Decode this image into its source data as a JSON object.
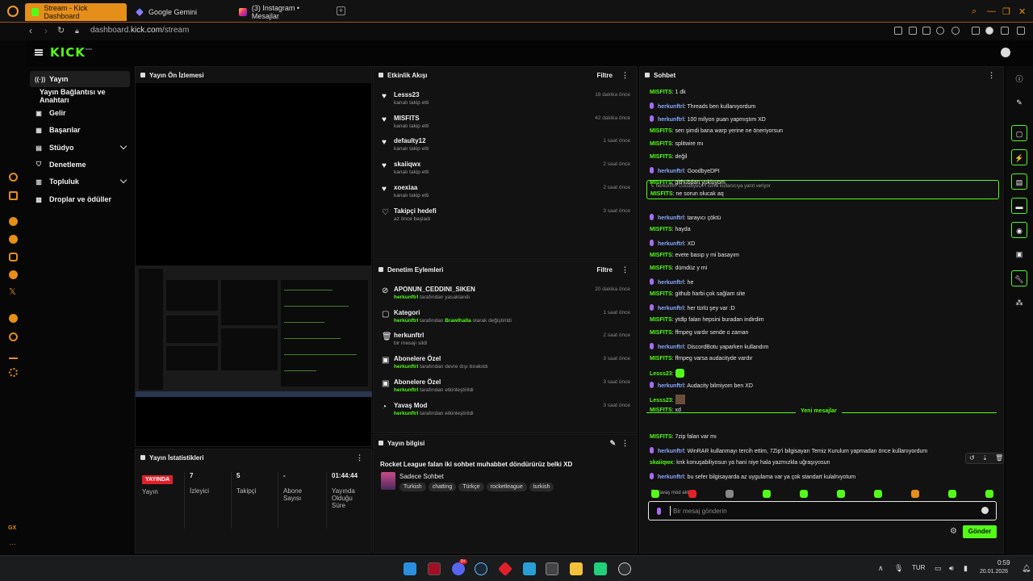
{
  "browser": {
    "tabs": [
      {
        "label": "Stream - Kick Dashboard",
        "active": true,
        "favicon": "kick-icon"
      },
      {
        "label": "Google Gemini",
        "active": false,
        "favicon": "gemini-icon"
      },
      {
        "label": "(3) Instagram • Mesajlar",
        "active": false,
        "favicon": "instagram-icon"
      }
    ],
    "url_host": "dashboard.",
    "url_bold": "kick.com",
    "url_path": "/stream",
    "accent": "#e58e19"
  },
  "sidebar_gx": {
    "bottom_label": "GX"
  },
  "kick": {
    "logo": "KICK",
    "logo_sup": "beta",
    "brand_green": "#53fc18"
  },
  "nav": {
    "items": [
      {
        "label": "Yayın",
        "icon": "broadcast-icon",
        "active": true
      },
      {
        "label": "Yayın Bağlantısı ve Anahtarı",
        "icon": "",
        "active": false
      },
      {
        "label": "Gelir",
        "icon": "wallet-icon",
        "active": false
      },
      {
        "label": "Başarılar",
        "icon": "trophy-icon",
        "active": false
      },
      {
        "label": "Stüdyo",
        "icon": "studio-icon",
        "active": false,
        "expandable": true
      },
      {
        "label": "Denetleme",
        "icon": "shield-icon",
        "active": false
      },
      {
        "label": "Topluluk",
        "icon": "community-icon",
        "active": false,
        "expandable": true
      },
      {
        "label": "Droplar ve ödüller",
        "icon": "gift-icon",
        "active": false
      }
    ]
  },
  "preview": {
    "title": "Yayın Ön İzlemesi"
  },
  "stats": {
    "title": "Yayın İstatistikleri",
    "live_badge": "YAYINDA",
    "items": [
      {
        "value": "",
        "label": "Yayın"
      },
      {
        "value": "7",
        "label": "İzleyici"
      },
      {
        "value": "5",
        "label": "Takipçi"
      },
      {
        "value": "-",
        "label": "Abone Sayısı"
      },
      {
        "value": "01:44:44",
        "label": "Yayında Olduğu Süre"
      }
    ]
  },
  "activity": {
    "title": "Etkinlik Akışı",
    "filter": "Filtre",
    "items": [
      {
        "name": "Lesss23",
        "sub": "kanalı takip etti",
        "time": "16 dakika önce"
      },
      {
        "name": "MISFITS",
        "sub": "kanalı takip etti",
        "time": "42 dakika önce"
      },
      {
        "name": "defaulty12",
        "sub": "kanalı takip etti",
        "time": "1 saat önce"
      },
      {
        "name": "skaiiqwx",
        "sub": "kanalı takip etti",
        "time": "2 saat önce"
      },
      {
        "name": "xoexiaa",
        "sub": "kanalı takip etti",
        "time": "2 saat önce"
      },
      {
        "name": "Takipçi hedefi",
        "sub": "az önce başladı",
        "time": "3 saat önce"
      }
    ]
  },
  "moderation": {
    "title": "Denetim Eylemleri",
    "filter": "Filtre",
    "items": [
      {
        "name": "APONUN_CEDDINI_SIKEN",
        "actor": "herkunftrl",
        "rest": " tarafından yasaklandı",
        "time": "20 dakika önce"
      },
      {
        "name": "Kategori",
        "actor": "herkunftrl",
        "rest": " tarafından ",
        "extra": "Brawlhalla",
        "rest2": " olarak değiştirildi",
        "time": "1 saat önce"
      },
      {
        "name": "herkunftrl",
        "actor": "",
        "rest": "bir mesajı sildi",
        "time": "2 saat önce"
      },
      {
        "name": "Abonelere Özel",
        "actor": "herkunftrl",
        "rest": " tarafından devre dışı bırakıldı",
        "time": "3 saat önce"
      },
      {
        "name": "Abonelere Özel",
        "actor": "herkunftrl",
        "rest": " tarafından etkinleştirildi",
        "time": "3 saat önce"
      },
      {
        "name": "Yavaş Mod",
        "actor": "herkunftrl",
        "rest": " tarafından etkinleştirildi",
        "time": "3 saat önce"
      }
    ]
  },
  "stream_info": {
    "title": "Yayın bilgisi",
    "stream_title": "Rocket League falan iki sohbet muhabbet döndürürüz belki XD",
    "category": "Sadece Sohbet",
    "tags": [
      "Turkish",
      "chatting",
      "Türkçe",
      "rocketleague",
      "turkish"
    ]
  },
  "chat": {
    "title": "Sohbet",
    "messages": [
      {
        "user": "MISFITS",
        "color": "g",
        "mic": false,
        "text": "1 dk"
      },
      {
        "user": "herkunftrl",
        "color": "b",
        "mic": true,
        "text": "Threads ben kullanıyordum"
      },
      {
        "user": "herkunftrl",
        "color": "b",
        "mic": true,
        "text": "100 milyon puan yapmıştım XD"
      },
      {
        "user": "MISFITS",
        "color": "g",
        "mic": false,
        "text": "sen şimdi bana warp yerine ne öneriyorsun"
      },
      {
        "user": "MISFITS",
        "color": "g",
        "mic": false,
        "text": "splitwire mı"
      },
      {
        "user": "MISFITS",
        "color": "g",
        "mic": false,
        "text": "değil"
      },
      {
        "user": "herkunftrl",
        "color": "b",
        "mic": true,
        "text": "GoodbyeDPI"
      },
      {
        "user": "MISFITS",
        "color": "g",
        "mic": false,
        "text": "githubdan yukluyom"
      }
    ],
    "reply_context": "↳ herkunftrl: GoodbyeDPI isimli kullanıcıya yanıt veriyor",
    "reply_user": "MISFITS",
    "reply_text": "ne sorun olucak aq",
    "messages2": [
      {
        "user": "herkunftrl",
        "color": "b",
        "mic": true,
        "text": "tarayıcı çöktü"
      },
      {
        "user": "MISFITS",
        "color": "g",
        "mic": false,
        "text": "hayda"
      },
      {
        "user": "herkunftrl",
        "color": "b",
        "mic": true,
        "text": "XD"
      },
      {
        "user": "MISFITS",
        "color": "g",
        "mic": false,
        "text": "evete basıp y mi basayım"
      },
      {
        "user": "MISFITS",
        "color": "g",
        "mic": false,
        "text": "dümdüz y mi"
      },
      {
        "user": "herkunftrl",
        "color": "b",
        "mic": true,
        "text": "he"
      },
      {
        "user": "MISFITS",
        "color": "g",
        "mic": false,
        "text": "github harbi çok sağlam site"
      },
      {
        "user": "herkunftrl",
        "color": "b",
        "mic": true,
        "text": "her türlü şey var :D"
      },
      {
        "user": "MISFITS",
        "color": "g",
        "mic": false,
        "text": "ytdlp falan hepsini buradan indirdim"
      },
      {
        "user": "MISFITS",
        "color": "g",
        "mic": false,
        "text": "ffmpeg vardır sende o zaman"
      },
      {
        "user": "herkunftrl",
        "color": "b",
        "mic": true,
        "text": "DiscordBotu yaparken kullandım"
      },
      {
        "user": "MISFITS",
        "color": "g",
        "mic": false,
        "text": "ffmpeg varsa audacityde vardır"
      },
      {
        "user": "Lesss23",
        "color": "g",
        "mic": false,
        "text": "",
        "emote": "green"
      },
      {
        "user": "herkunftrl",
        "color": "b",
        "mic": true,
        "text": "Audacity bilmiyom ben XD"
      },
      {
        "user": "Lesss23",
        "color": "g",
        "mic": false,
        "text": "",
        "emote": "photo"
      },
      {
        "user": "MISFITS",
        "color": "g",
        "mic": false,
        "text": "xd"
      }
    ],
    "new_messages_label": "Yeni mesajlar",
    "messages3": [
      {
        "user": "MISFITS",
        "color": "g",
        "mic": false,
        "text": "7zip falan var mı"
      },
      {
        "user": "herkunftrl",
        "color": "b",
        "mic": true,
        "text": "WinRAR kullanmayı tercih ettim, 7Zip'i bilgisayarı Temiz Kurulum yapmadan önce kullanıyordum"
      },
      {
        "user": "skaiiqwx",
        "color": "g",
        "mic": false,
        "text": "knk konuşabiliyosun ya hani niye hala yazmızkla uğraşıyosun"
      },
      {
        "user": "herkunftrl",
        "color": "b",
        "mic": true,
        "text": "bu sefer bilgisayarda az uygulama var ya çok standart kulalnıyotum"
      }
    ],
    "slow_mode_notice": "Yavaş mod aktif",
    "input_placeholder": "Bir mesaj gönderin",
    "send_label": "Gönder"
  },
  "taskbar": {
    "lang": "TUR",
    "time": "0:59",
    "date": "20.01.2026",
    "discord_badge": "9+"
  }
}
